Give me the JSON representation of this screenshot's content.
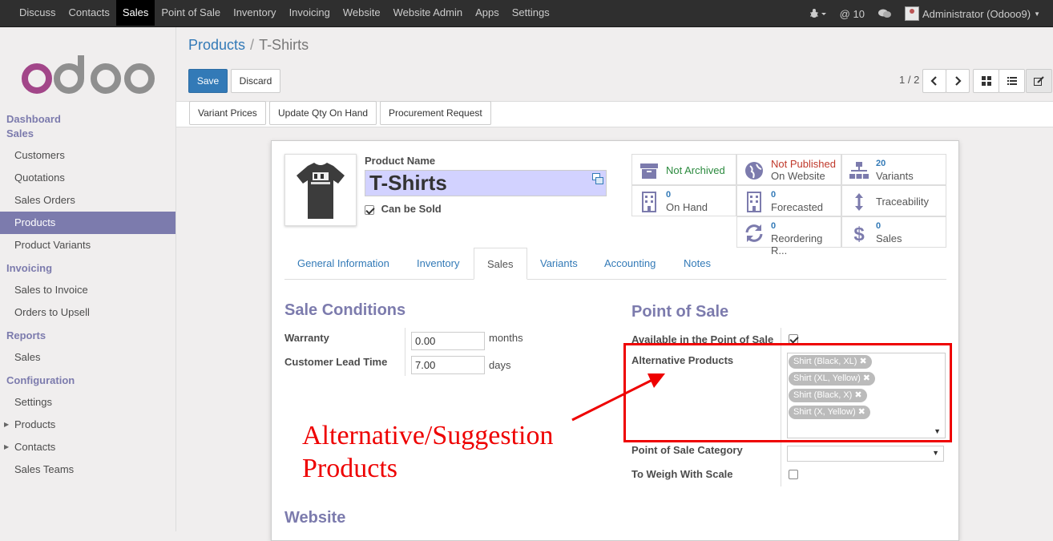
{
  "topbar": {
    "nav": [
      "Discuss",
      "Contacts",
      "Sales",
      "Point of Sale",
      "Inventory",
      "Invoicing",
      "Website",
      "Website Admin",
      "Apps",
      "Settings"
    ],
    "active": "Sales",
    "mentions": "@ 10",
    "user": "Administrator (Odooo9)"
  },
  "sidebar": {
    "logo": "odoo",
    "dashboard": "Dashboard",
    "sections": [
      {
        "title": "Sales",
        "items": [
          "Customers",
          "Quotations",
          "Sales Orders",
          "Products",
          "Product Variants"
        ]
      },
      {
        "title": "Invoicing",
        "items": [
          "Sales to Invoice",
          "Orders to Upsell"
        ]
      },
      {
        "title": "Reports",
        "items": [
          "Sales"
        ]
      },
      {
        "title": "Configuration",
        "items": [
          "Settings",
          "Products",
          "Contacts",
          "Sales Teams"
        ]
      }
    ],
    "active_item": "Products"
  },
  "control": {
    "breadcrumb_parent": "Products",
    "breadcrumb_current": "T-Shirts",
    "save": "Save",
    "discard": "Discard",
    "pager": "1 / 2"
  },
  "statusbar": {
    "buttons": [
      "Variant Prices",
      "Update Qty On Hand",
      "Procurement Request"
    ]
  },
  "product": {
    "name_label": "Product Name",
    "name": "T-Shirts",
    "can_be_sold": "Can be Sold"
  },
  "smart_buttons": {
    "archived": "Not Archived",
    "published_1": "Not Published",
    "published_2": "On Website",
    "variants_num": "20",
    "variants": "Variants",
    "onhand_num": "0",
    "onhand": "On Hand",
    "forecast_num": "0",
    "forecast": "Forecasted",
    "traceability": "Traceability",
    "reorder_num": "0",
    "reorder": "Reordering R...",
    "sales_num": "0",
    "sales": "Sales"
  },
  "tabs": [
    "General Information",
    "Inventory",
    "Sales",
    "Variants",
    "Accounting",
    "Notes"
  ],
  "active_tab": "Sales",
  "sale_conditions": {
    "title": "Sale Conditions",
    "warranty_label": "Warranty",
    "warranty_value": "0.00",
    "warranty_unit": "months",
    "lead_label": "Customer Lead Time",
    "lead_value": "7.00",
    "lead_unit": "days"
  },
  "pos": {
    "title": "Point of Sale",
    "available_label": "Available in the Point of Sale",
    "alt_label": "Alternative Products",
    "alt_tags": [
      "Shirt (Black, XL)",
      "Shirt (XL, Yellow)",
      "Shirt (Black, X)",
      "Shirt (X, Yellow)"
    ],
    "category_label": "Point of Sale Category",
    "weigh_label": "To Weigh With Scale"
  },
  "website_title": "Website",
  "annotation": {
    "line1": "Alternative/Suggestion",
    "line2": "Products",
    "color": "#e00000"
  }
}
